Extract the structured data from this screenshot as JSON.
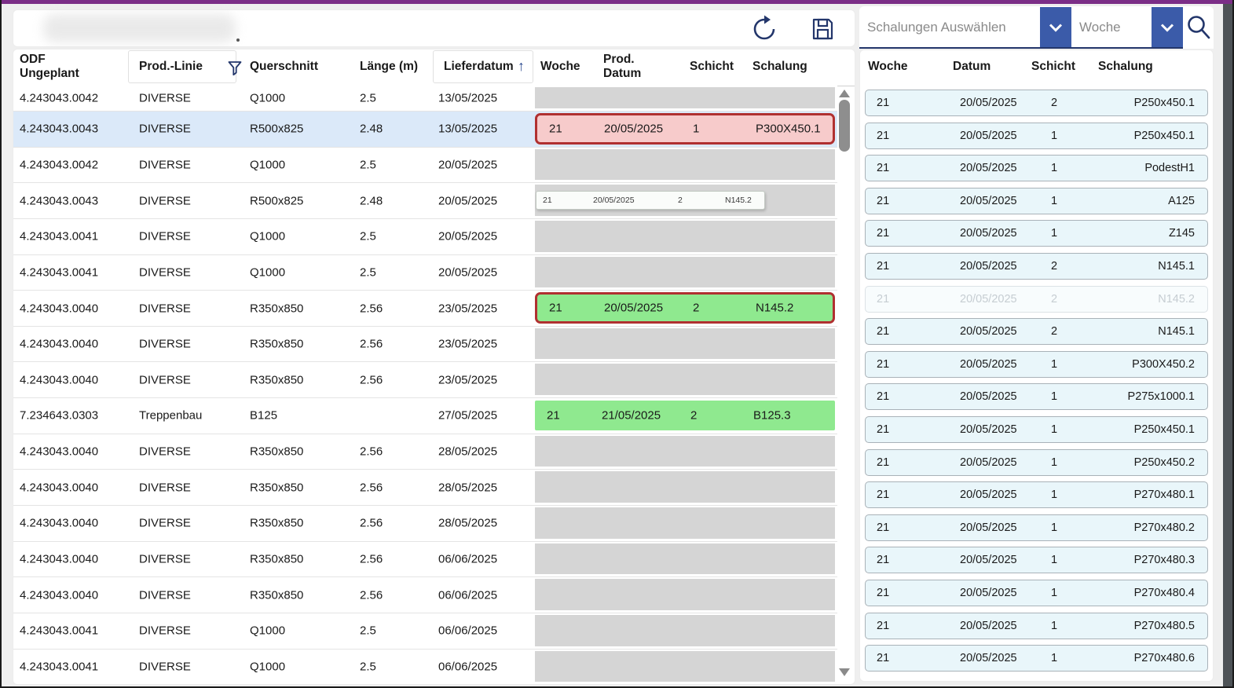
{
  "colors": {
    "titlebar_purple": "#7B2E87",
    "accent_blue": "#3B5BA9",
    "icon_navy": "#23366B",
    "plan_empty_gray": "#D5D5D5",
    "plan_red_fill": "#F7CBCB",
    "plan_red_border": "#B03030",
    "plan_green_fill": "#8FE98F",
    "selected_row_blue": "#DBE9F9",
    "card_fill": "#E9F6FA"
  },
  "toolbar": {
    "refresh_icon": "refresh-icon",
    "save_icon": "save-icon"
  },
  "filters": {
    "schalungen_placeholder": "Schalungen Auswählen",
    "woche_value": "Woche"
  },
  "left_table": {
    "headers": {
      "odf": "ODF\nUngeplant",
      "prod_linie": "Prod.-Linie",
      "querschnitt": "Querschnitt",
      "laenge": "Länge (m)",
      "lieferdatum": "Lieferdatum",
      "woche": "Woche",
      "prod_datum": "Prod.\nDatum",
      "schicht": "Schicht",
      "schalung": "Schalung"
    },
    "sort_indicator": "↑",
    "rows": [
      {
        "odf": "4.243043.0042",
        "linie": "DIVERSE",
        "querschnitt": "Q1000",
        "laenge": "2.5",
        "lieferdatum": "13/05/2025",
        "selected": false,
        "plan": null
      },
      {
        "odf": "4.243043.0043",
        "linie": "DIVERSE",
        "querschnitt": "R500x825",
        "laenge": "2.48",
        "lieferdatum": "13/05/2025",
        "selected": true,
        "plan": {
          "type": "red",
          "woche": "21",
          "datum": "20/05/2025",
          "schicht": "1",
          "schalung": "P300X450.1"
        }
      },
      {
        "odf": "4.243043.0042",
        "linie": "DIVERSE",
        "querschnitt": "Q1000",
        "laenge": "2.5",
        "lieferdatum": "20/05/2025",
        "selected": false,
        "plan": null
      },
      {
        "odf": "4.243043.0043",
        "linie": "DIVERSE",
        "querschnitt": "R500x825",
        "laenge": "2.48",
        "lieferdatum": "20/05/2025",
        "selected": false,
        "plan": {
          "type": "ghost",
          "woche": "21",
          "datum": "20/05/2025",
          "schicht": "2",
          "schalung": "N145.2"
        }
      },
      {
        "odf": "4.243043.0041",
        "linie": "DIVERSE",
        "querschnitt": "Q1000",
        "laenge": "2.5",
        "lieferdatum": "20/05/2025",
        "selected": false,
        "plan": null
      },
      {
        "odf": "4.243043.0041",
        "linie": "DIVERSE",
        "querschnitt": "Q1000",
        "laenge": "2.5",
        "lieferdatum": "20/05/2025",
        "selected": false,
        "plan": null
      },
      {
        "odf": "4.243043.0040",
        "linie": "DIVERSE",
        "querschnitt": "R350x850",
        "laenge": "2.56",
        "lieferdatum": "23/05/2025",
        "selected": false,
        "plan": {
          "type": "green-red",
          "woche": "21",
          "datum": "20/05/2025",
          "schicht": "2",
          "schalung": "N145.2"
        }
      },
      {
        "odf": "4.243043.0040",
        "linie": "DIVERSE",
        "querschnitt": "R350x850",
        "laenge": "2.56",
        "lieferdatum": "23/05/2025",
        "selected": false,
        "plan": null
      },
      {
        "odf": "4.243043.0040",
        "linie": "DIVERSE",
        "querschnitt": "R350x850",
        "laenge": "2.56",
        "lieferdatum": "23/05/2025",
        "selected": false,
        "plan": null
      },
      {
        "odf": "7.234643.0303",
        "linie": "Treppenbau",
        "querschnitt": "B125",
        "laenge": "",
        "lieferdatum": "27/05/2025",
        "selected": false,
        "plan": {
          "type": "green",
          "woche": "21",
          "datum": "21/05/2025",
          "schicht": "2",
          "schalung": "B125.3"
        }
      },
      {
        "odf": "4.243043.0040",
        "linie": "DIVERSE",
        "querschnitt": "R350x850",
        "laenge": "2.56",
        "lieferdatum": "28/05/2025",
        "selected": false,
        "plan": null
      },
      {
        "odf": "4.243043.0040",
        "linie": "DIVERSE",
        "querschnitt": "R350x850",
        "laenge": "2.56",
        "lieferdatum": "28/05/2025",
        "selected": false,
        "plan": null
      },
      {
        "odf": "4.243043.0040",
        "linie": "DIVERSE",
        "querschnitt": "R350x850",
        "laenge": "2.56",
        "lieferdatum": "28/05/2025",
        "selected": false,
        "plan": null
      },
      {
        "odf": "4.243043.0040",
        "linie": "DIVERSE",
        "querschnitt": "R350x850",
        "laenge": "2.56",
        "lieferdatum": "06/06/2025",
        "selected": false,
        "plan": null
      },
      {
        "odf": "4.243043.0040",
        "linie": "DIVERSE",
        "querschnitt": "R350x850",
        "laenge": "2.56",
        "lieferdatum": "06/06/2025",
        "selected": false,
        "plan": null
      },
      {
        "odf": "4.243043.0041",
        "linie": "DIVERSE",
        "querschnitt": "Q1000",
        "laenge": "2.5",
        "lieferdatum": "06/06/2025",
        "selected": false,
        "plan": null
      },
      {
        "odf": "4.243043.0041",
        "linie": "DIVERSE",
        "querschnitt": "Q1000",
        "laenge": "2.5",
        "lieferdatum": "06/06/2025",
        "selected": false,
        "plan": null
      }
    ]
  },
  "right_table": {
    "headers": {
      "woche": "Woche",
      "datum": "Datum",
      "schicht": "Schicht",
      "schalung": "Schalung"
    },
    "rows": [
      {
        "woche": "21",
        "datum": "20/05/2025",
        "schicht": "2",
        "schalung": "P250x450.1",
        "faded": false
      },
      {
        "woche": "21",
        "datum": "20/05/2025",
        "schicht": "1",
        "schalung": "P250x450.1",
        "faded": false
      },
      {
        "woche": "21",
        "datum": "20/05/2025",
        "schicht": "1",
        "schalung": "PodestH1",
        "faded": false
      },
      {
        "woche": "21",
        "datum": "20/05/2025",
        "schicht": "1",
        "schalung": "A125",
        "faded": false
      },
      {
        "woche": "21",
        "datum": "20/05/2025",
        "schicht": "1",
        "schalung": "Z145",
        "faded": false
      },
      {
        "woche": "21",
        "datum": "20/05/2025",
        "schicht": "2",
        "schalung": "N145.1",
        "faded": false
      },
      {
        "woche": "21",
        "datum": "20/05/2025",
        "schicht": "2",
        "schalung": "N145.2",
        "faded": true
      },
      {
        "woche": "21",
        "datum": "20/05/2025",
        "schicht": "2",
        "schalung": "N145.1",
        "faded": false
      },
      {
        "woche": "21",
        "datum": "20/05/2025",
        "schicht": "1",
        "schalung": "P300X450.2",
        "faded": false
      },
      {
        "woche": "21",
        "datum": "20/05/2025",
        "schicht": "1",
        "schalung": "P275x1000.1",
        "faded": false
      },
      {
        "woche": "21",
        "datum": "20/05/2025",
        "schicht": "1",
        "schalung": "P250x450.1",
        "faded": false
      },
      {
        "woche": "21",
        "datum": "20/05/2025",
        "schicht": "1",
        "schalung": "P250x450.2",
        "faded": false
      },
      {
        "woche": "21",
        "datum": "20/05/2025",
        "schicht": "1",
        "schalung": "P270x480.1",
        "faded": false
      },
      {
        "woche": "21",
        "datum": "20/05/2025",
        "schicht": "1",
        "schalung": "P270x480.2",
        "faded": false
      },
      {
        "woche": "21",
        "datum": "20/05/2025",
        "schicht": "1",
        "schalung": "P270x480.3",
        "faded": false
      },
      {
        "woche": "21",
        "datum": "20/05/2025",
        "schicht": "1",
        "schalung": "P270x480.4",
        "faded": false
      },
      {
        "woche": "21",
        "datum": "20/05/2025",
        "schicht": "1",
        "schalung": "P270x480.5",
        "faded": false
      },
      {
        "woche": "21",
        "datum": "20/05/2025",
        "schicht": "1",
        "schalung": "P270x480.6",
        "faded": false
      }
    ]
  }
}
